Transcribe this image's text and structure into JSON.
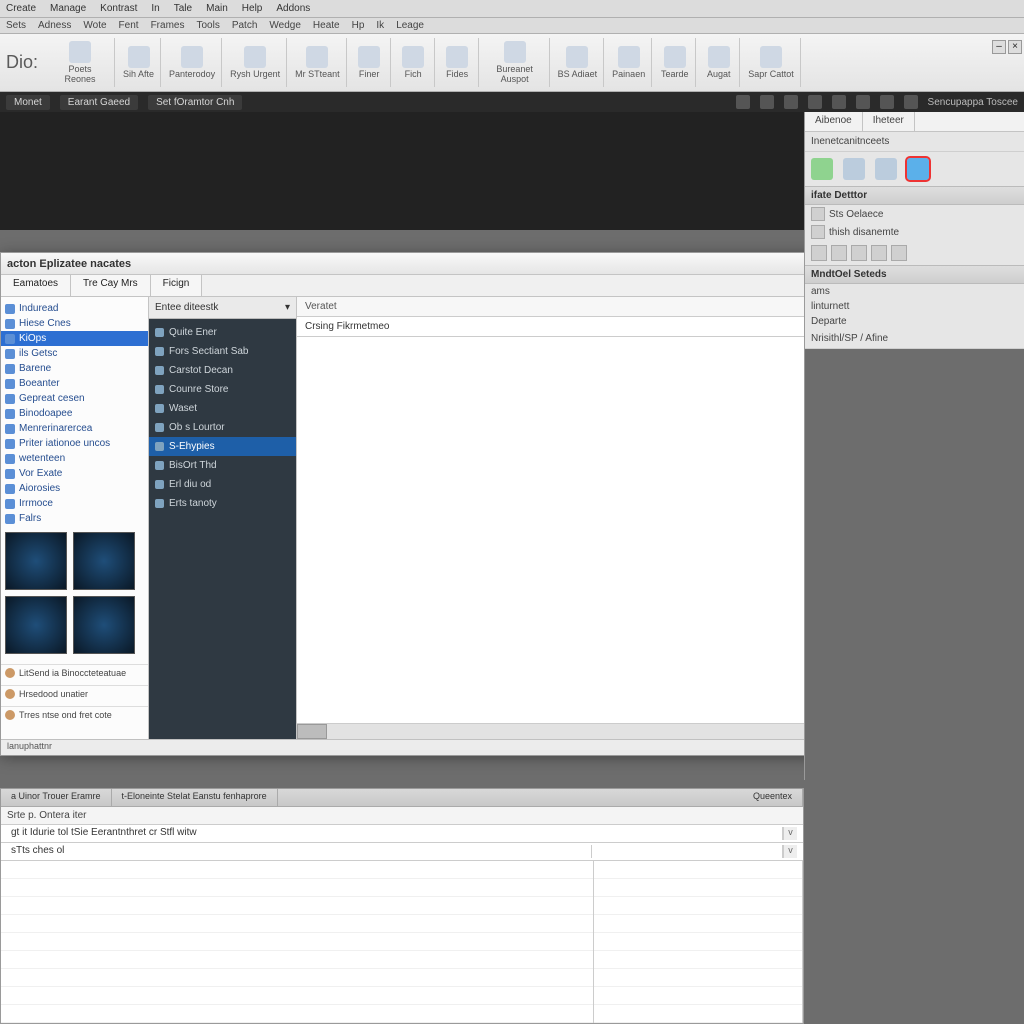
{
  "menubar1": [
    "Create",
    "Manage",
    "Kontrast",
    "In",
    "Tale",
    "Main",
    "Help",
    "Addons"
  ],
  "menubar2": [
    "Sets",
    "Adness",
    "Wote",
    "Fent",
    "Frames",
    "Tools",
    "Patch",
    "Wedge",
    "Heate",
    "Hp",
    "Ik",
    "Leage"
  ],
  "ribbon_label": "Dio:",
  "ribbon_groups": [
    {
      "label": "Poets Reones"
    },
    {
      "label": "Sih Afte"
    },
    {
      "label": "Panterodoy"
    },
    {
      "label": "Rysh Urgent"
    },
    {
      "label": "Mr STteant"
    },
    {
      "label": "Finer"
    },
    {
      "label": "Fich"
    },
    {
      "label": "Fides"
    },
    {
      "label": "Bureanet Auspot"
    },
    {
      "label": "BS Adiaet"
    },
    {
      "label": "Painaen"
    },
    {
      "label": "Tearde"
    },
    {
      "label": "Augat"
    },
    {
      "label": "Sapr Cattot"
    }
  ],
  "darktabs": {
    "items": [
      "Monet",
      "Earant Gaeed",
      "Set fOramtor Cnh"
    ],
    "right": "Sencupappa Toscee"
  },
  "explorer": {
    "title": "acton Eplizatee nacates",
    "tabs": [
      "Eamatoes",
      "Tre Cay Mrs",
      "Ficign"
    ],
    "tree": [
      "Induread",
      "Hiese Cnes",
      "KiOps",
      "ils Getsc",
      "Barene",
      "Boeanter",
      "Gepreat cesen",
      "Binodoapee",
      "Menrerinarercea",
      "Priter iationoe uncos",
      "wetenteen",
      "Vor Exate",
      "Aiorosies",
      "Irrmoce",
      "Falrs"
    ],
    "tree_selected": 2,
    "tree_footer": [
      "LitSend ia Binoccteteatuae",
      "Hrsedood unatier",
      "Trres ntse ond fret cote"
    ],
    "mid_header": "Entee diteestk",
    "mid_items": [
      "Quite Ener",
      "Fors Sectiant Sab",
      "Carstot Decan",
      "Counre Store",
      "Waset",
      "Ob s Lourtor",
      "S-Ehypies",
      "BisOrt Thd",
      "Erl diu od",
      "Erts tanoty"
    ],
    "mid_selected": 6,
    "content_header": "Veratet",
    "breadcrumb": "Crsing Fikrmetmeo"
  },
  "status": "lanuphattnr",
  "bottom": {
    "tabs": [
      "a Uinor Trouer Eramre",
      "t-Eloneinte Stelat Eanstu fenhaprore"
    ],
    "dd": "Queentex",
    "row1": "Srte p. Ontera iter",
    "row2a": "gt it Idurie tol tSie Eerantnthret cr Stfl witw",
    "row2b": "sTts ches ol"
  },
  "right": {
    "tabs": [
      "Aibenoe",
      "Iheteer"
    ],
    "sec1": "Inenetcanitnceets",
    "head1": "ifate Detttor",
    "rows1": [
      "Sts Oelaece",
      "thish disanemte"
    ],
    "head2": "MndtOel Seteds",
    "rows2": [
      "ams",
      "linturnett",
      "Departe"
    ],
    "foot": "Nrisithl/SP / Afine"
  }
}
